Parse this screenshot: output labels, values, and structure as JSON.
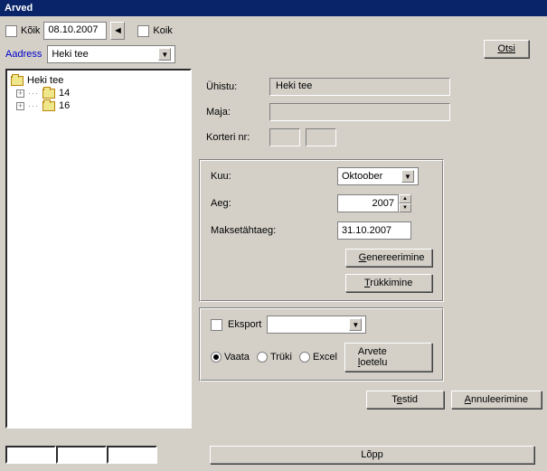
{
  "title": "Arved",
  "toolbar": {
    "koik1_label": "Kõik",
    "date": "08.10.2007",
    "koik2_label": "Koik"
  },
  "aadress_label": "Aadress",
  "aadress_value": "Heki tee",
  "otsi_label": "Otsi",
  "tree": {
    "root": "Heki tee",
    "children": [
      "14",
      "16"
    ]
  },
  "fields": {
    "uhistu_label": "Ühistu:",
    "uhistu_value": "Heki tee",
    "maja_label": "Maja:",
    "maja_value": "",
    "korteri_label": "Korteri nr:"
  },
  "period": {
    "kuu_label": "Kuu:",
    "kuu_value": "Oktoober",
    "aeg_label": "Aeg:",
    "aeg_value": "2007",
    "makse_label": "Maksetähtaeg:",
    "makse_value": "31.10.2007",
    "genereerimine": "Genereerimine",
    "trukkimine": "Trükkimine"
  },
  "export": {
    "eksport_label": "Eksport",
    "vaata": "Vaata",
    "truki": "Trüki",
    "excel": "Excel",
    "arvete_loetelu": "Arvete loetelu"
  },
  "testid": "Testid",
  "annul": "Annuleerimine",
  "lopp": "Lõpp"
}
